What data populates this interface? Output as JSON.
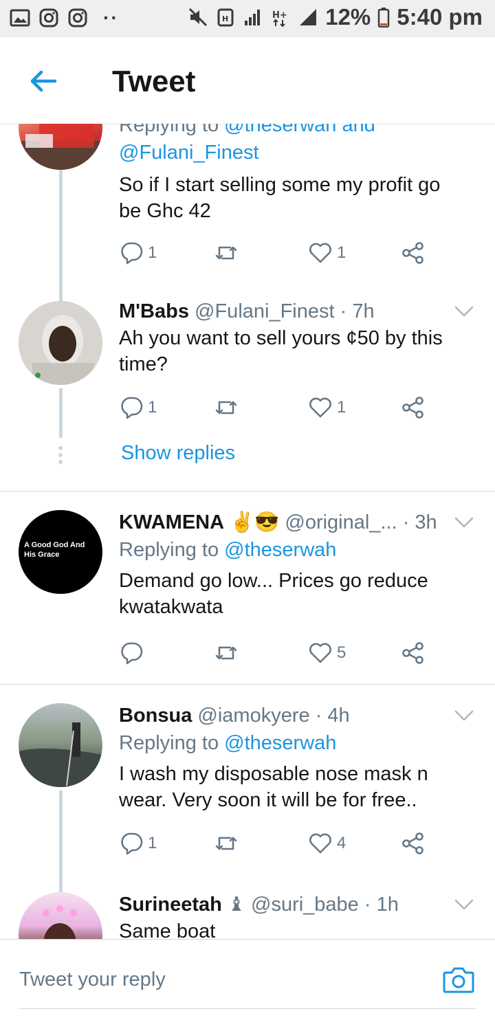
{
  "status_bar": {
    "left_icons": [
      "gallery-icon",
      "instagram-icon",
      "instagram-icon"
    ],
    "dots": "··",
    "right_icons": [
      "mute-icon",
      "data-saver-icon",
      "signal-icon",
      "h-plus-icon",
      "signal-icon"
    ],
    "battery": "12%",
    "time": "5:40 pm"
  },
  "header": {
    "title": "Tweet"
  },
  "tweets": [
    {
      "replying_prefix": "Replying to ",
      "replying_to_1": "@theserwah and",
      "replying_to_2": "@Fulani_Finest",
      "text": "So if I start selling some my profit go be Ghc 42",
      "replies": "1",
      "retweets": "",
      "likes": "1"
    },
    {
      "name": "M'Babs",
      "handle": "@Fulani_Finest",
      "time": "· 7h",
      "text": "Ah you want to sell yours ¢50 by this time?",
      "replies": "1",
      "retweets": "",
      "likes": "1",
      "show_replies": "Show replies"
    },
    {
      "name": "KWAMENA",
      "emoji": "✌😎",
      "handle": "@original_...",
      "time": "· 3h",
      "replying_prefix": "Replying to ",
      "replying_to": "@theserwah",
      "avatar_text": "A Good God And His Grace",
      "text": "Demand go low... Prices go reduce kwatakwata",
      "replies": "",
      "retweets": "",
      "likes": "5"
    },
    {
      "name": "Bonsua",
      "handle": "@iamokyere",
      "time": "· 4h",
      "replying_prefix": "Replying to ",
      "replying_to": "@theserwah",
      "text": "I wash my disposable nose mask n wear. Very soon it will be for free..",
      "replies": "1",
      "retweets": "",
      "likes": "4"
    },
    {
      "name": "Surineetah",
      "emoji": "♝",
      "handle": "@suri_babe",
      "time": "· 1h",
      "text": "Same boat"
    }
  ],
  "compose": {
    "placeholder": "Tweet your reply"
  },
  "colors": {
    "accent": "#1b95e0",
    "text": "#14171a",
    "secondary": "#657786",
    "border": "#ccd6dd"
  }
}
